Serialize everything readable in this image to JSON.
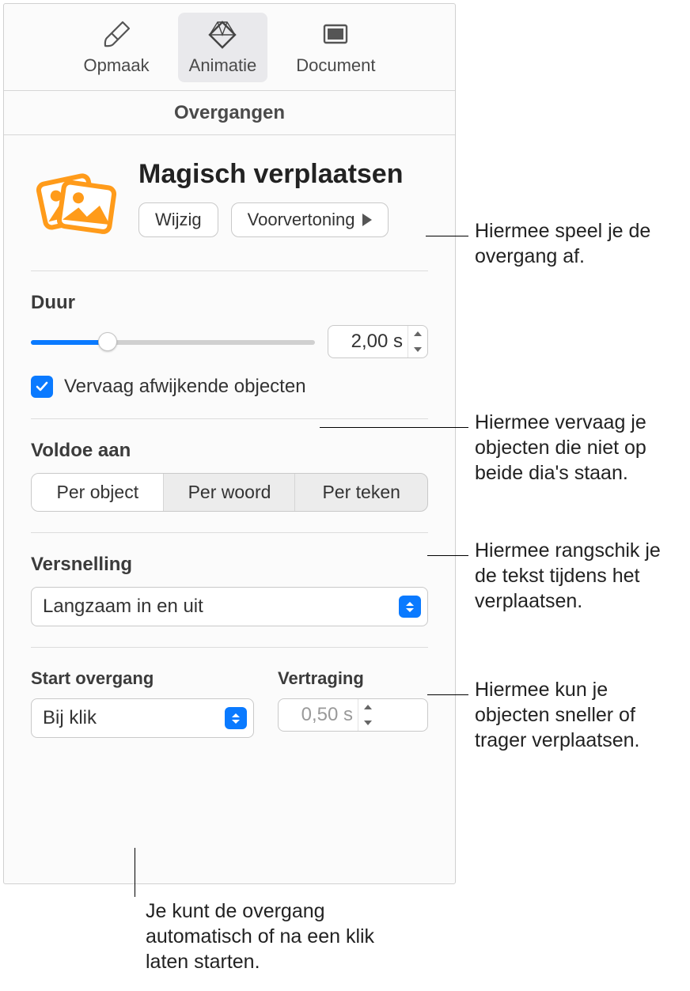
{
  "tabs": {
    "format": "Opmaak",
    "animate": "Animatie",
    "document": "Document"
  },
  "subheader": "Overgangen",
  "header": {
    "title": "Magisch verplaatsen",
    "change": "Wijzig",
    "preview": "Voorvertoning"
  },
  "duration": {
    "label": "Duur",
    "value": "2,00 s"
  },
  "fade": {
    "label": "Vervaag afwijkende objecten",
    "checked": true
  },
  "match": {
    "label": "Voldoe aan",
    "options": [
      "Per object",
      "Per woord",
      "Per teken"
    ],
    "selected": 0
  },
  "accel": {
    "label": "Versnelling",
    "value": "Langzaam in en uit"
  },
  "start": {
    "label": "Start overgang",
    "value": "Bij klik"
  },
  "delay": {
    "label": "Vertraging",
    "value": "0,50 s"
  },
  "callouts": {
    "preview": "Hiermee speel je de overgang af.",
    "fade": "Hiermee vervaag je objecten die niet op beide dia's staan.",
    "match": "Hiermee rangschik je de tekst tijdens het verplaatsen.",
    "accel": "Hiermee kun je objecten sneller of trager verplaatsen.",
    "start": "Je kunt de overgang automatisch of na een klik laten starten."
  }
}
